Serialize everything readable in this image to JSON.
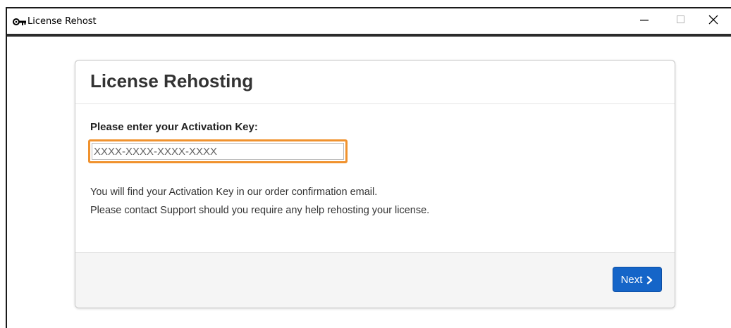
{
  "window": {
    "title": "License Rehost",
    "icon": "key-icon",
    "controls": {
      "minimize_icon": "minimize-icon",
      "maximize_icon": "maximize-icon",
      "close_icon": "close-icon"
    }
  },
  "card": {
    "title": "License Rehosting",
    "field_label": "Please enter your Activation Key:",
    "key_input": {
      "value": "",
      "placeholder": "XXXX-XXXX-XXXX-XXXX"
    },
    "help_lines": [
      "You will find your Activation Key in our order confirmation email.",
      "Please contact Support should you require any help rehosting your license."
    ],
    "next_label": "Next",
    "next_icon": "chevron-right-icon"
  },
  "colors": {
    "highlight": "#f0922e",
    "primary_button": "#1565c8",
    "footer_bg": "#f5f5f5"
  }
}
